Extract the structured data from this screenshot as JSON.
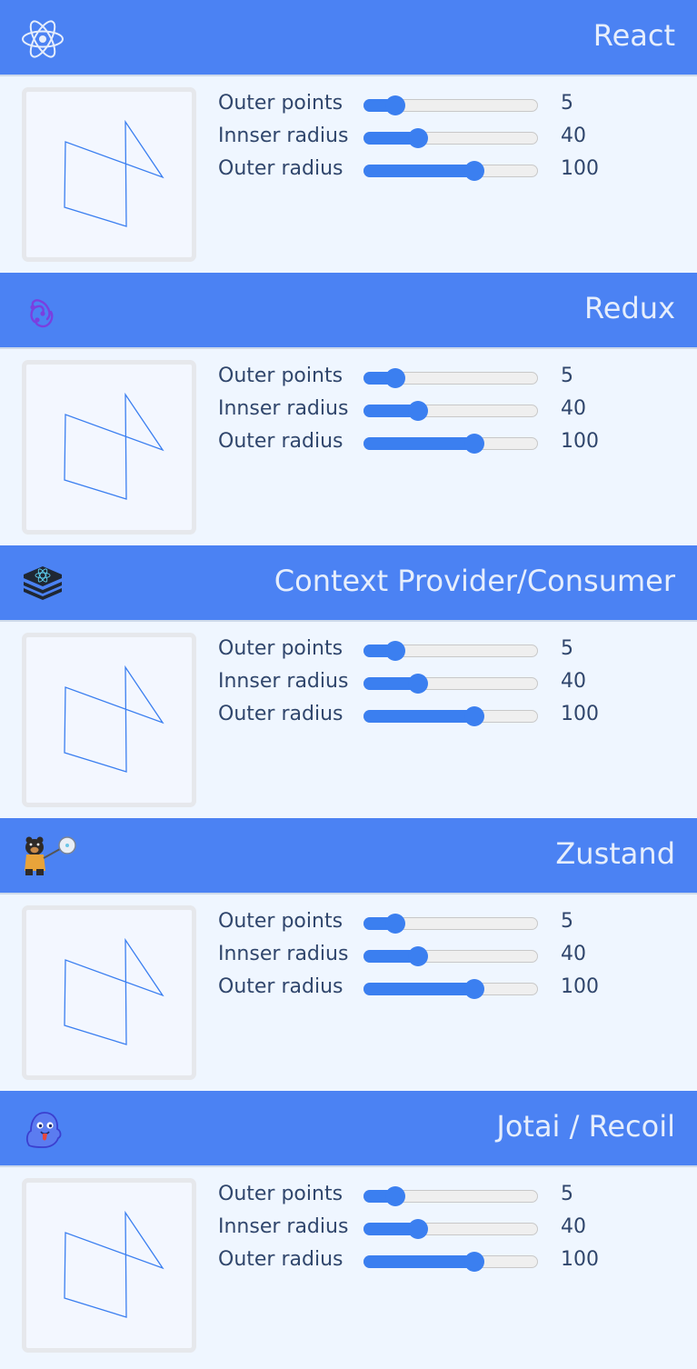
{
  "colors": {
    "header": "#4b82f3",
    "accent": "#3b7ff0",
    "star": "#3b7ff0"
  },
  "sections": [
    {
      "title": "React",
      "icon": "react-atom-icon",
      "controls": [
        {
          "label": "Outer points",
          "value": "5",
          "fraction": 0.14
        },
        {
          "label": "Innser radius",
          "value": "40",
          "fraction": 0.29
        },
        {
          "label": "Outer radius",
          "value": "100",
          "fraction": 0.65
        }
      ]
    },
    {
      "title": "Redux",
      "icon": "redux-icon",
      "controls": [
        {
          "label": "Outer points",
          "value": "5",
          "fraction": 0.14
        },
        {
          "label": "Innser radius",
          "value": "40",
          "fraction": 0.29
        },
        {
          "label": "Outer radius",
          "value": "100",
          "fraction": 0.65
        }
      ]
    },
    {
      "title": "Context Provider/Consumer",
      "icon": "layers-stack-icon",
      "controls": [
        {
          "label": "Outer points",
          "value": "5",
          "fraction": 0.14
        },
        {
          "label": "Innser radius",
          "value": "40",
          "fraction": 0.29
        },
        {
          "label": "Outer radius",
          "value": "100",
          "fraction": 0.65
        }
      ]
    },
    {
      "title": "Zustand",
      "icon": "zustand-bear-icon",
      "controls": [
        {
          "label": "Outer points",
          "value": "5",
          "fraction": 0.14
        },
        {
          "label": "Innser radius",
          "value": "40",
          "fraction": 0.29
        },
        {
          "label": "Outer radius",
          "value": "100",
          "fraction": 0.65
        }
      ]
    },
    {
      "title": "Jotai / Recoil",
      "icon": "jotai-ghost-icon",
      "controls": [
        {
          "label": "Outer points",
          "value": "5",
          "fraction": 0.14
        },
        {
          "label": "Innser radius",
          "value": "40",
          "fraction": 0.29
        },
        {
          "label": "Outer radius",
          "value": "100",
          "fraction": 0.65
        }
      ]
    }
  ]
}
